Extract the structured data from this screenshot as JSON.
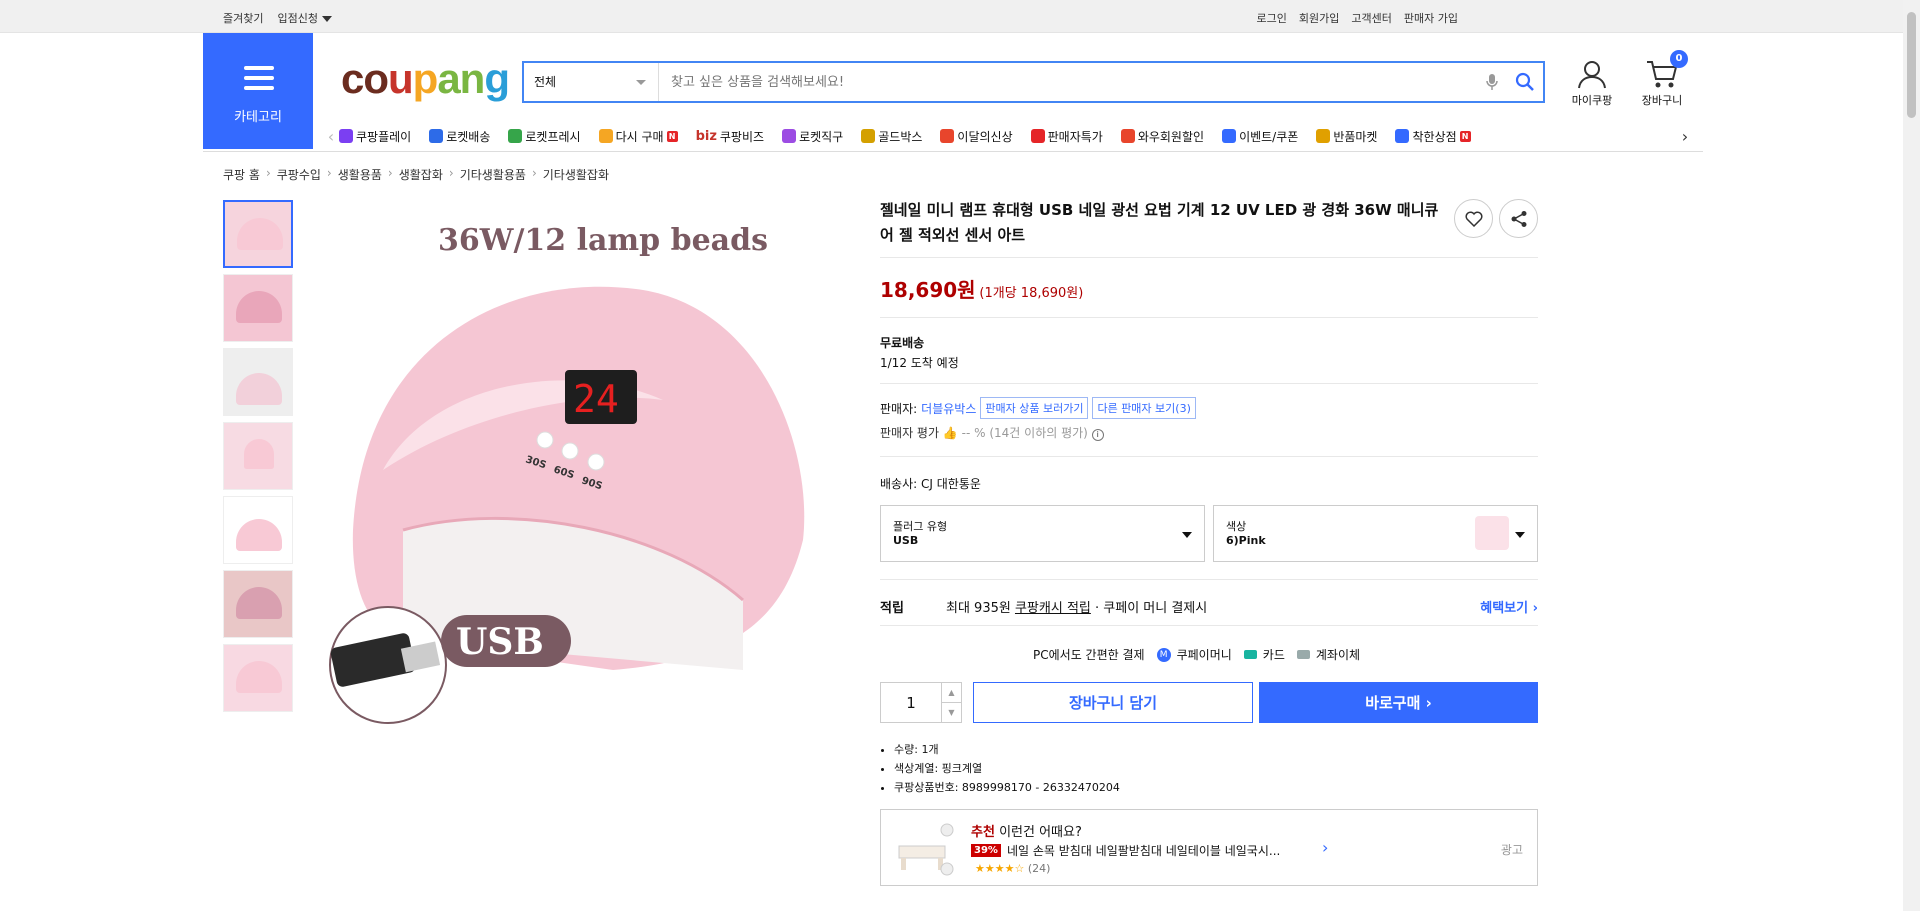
{
  "topbar": {
    "bookmark": "즐겨찾기",
    "partner": "입점신청",
    "login": "로그인",
    "signup": "회원가입",
    "service": "고객센터",
    "seller_join": "판매자 가입"
  },
  "category": {
    "label": "카테고리"
  },
  "logo": {
    "parts": [
      "co",
      "u",
      "p",
      "an",
      "g"
    ]
  },
  "search": {
    "scope": "전체",
    "placeholder": "찾고 싶은 상품을 검색해보세요!"
  },
  "header": {
    "mycoupang": "마이쿠팡",
    "cart": "장바구니",
    "cart_count": "0"
  },
  "nav": [
    {
      "label": "쿠팡플레이",
      "color": "#7b3ff2"
    },
    {
      "label": "로켓배송",
      "color": "#2d6be8"
    },
    {
      "label": "로켓프레시",
      "color": "#36a54a"
    },
    {
      "label": "다시 구매",
      "color": "#f5a623"
    },
    {
      "label": "쿠팡비즈",
      "color": "#c6342b",
      "prefix": "biz"
    },
    {
      "label": "로켓직구",
      "color": "#9c4ce3"
    },
    {
      "label": "골드박스",
      "color": "#d4a000"
    },
    {
      "label": "이달의신상",
      "color": "#e8452c"
    },
    {
      "label": "판매자특가",
      "color": "#e52528"
    },
    {
      "label": "와우회원할인",
      "color": "#e8452c"
    },
    {
      "label": "이벤트/쿠폰",
      "color": "#346aff"
    },
    {
      "label": "반품마켓",
      "color": "#e0a000"
    },
    {
      "label": "착한상점",
      "color": "#346aff"
    }
  ],
  "breadcrumb": [
    "쿠팡 홈",
    "쿠팡수입",
    "생활용품",
    "생활잡화",
    "기타생활용품",
    "기타생활잡화"
  ],
  "image": {
    "banner": "36W/12 lamp beads",
    "usb_label": "USB",
    "buttons": [
      "30S",
      "60S",
      "90S"
    ],
    "display": "24"
  },
  "product": {
    "title": "젤네일 미니 램프 휴대형 USB 네일 광선 요법 기계 12 UV LED 광 경화 36W 매니큐어 젤 적외선 센서 아트",
    "price": "18,690원",
    "unit_price": "(1개당 18,690원)",
    "shipping": "무료배송",
    "arrival": "1/12 도착 예정",
    "seller_label": "판매자:",
    "seller_name": "더블유박스",
    "seller_products": "판매자 상품 보러가기",
    "other_sellers": "다른 판매자 보기",
    "other_count": "(3)",
    "rating_label": "판매자 평가",
    "rating_value": "-- %",
    "rating_note": "(14건 이하의 평가)",
    "carrier_label": "배송사:",
    "carrier": "CJ 대한통운",
    "options": [
      {
        "name": "플러그 유형",
        "value": "USB"
      },
      {
        "name": "색상",
        "value": "6)Pink"
      }
    ],
    "reward_title": "적립",
    "reward_prefix": "최대 935원",
    "reward_link": "쿠팡캐시 적립",
    "reward_suffix": "· 쿠페이 머니 결제시",
    "benefit": "혜택보기 ›",
    "pay_label": "PC에서도 간편한 결제",
    "pay_methods": [
      "쿠페이머니",
      "카드",
      "계좌이체"
    ],
    "quantity": "1",
    "add_cart": "장바구니 담기",
    "buy_now": "바로구매 ›",
    "specs": [
      "수량: 1개",
      "색상계열: 핑크계열",
      "쿠팡상품번호: 8989998170 - 26332470204"
    ]
  },
  "reco": {
    "prefix": "추천",
    "heading": "이런건 어때요?",
    "discount": "39%",
    "name": "네일 손목 받침대 네일팔받침대 네일테이블 네일국시...",
    "rating_count": "(24)",
    "ad": "광고"
  }
}
